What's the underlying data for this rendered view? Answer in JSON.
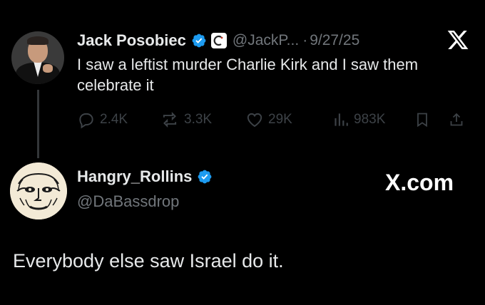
{
  "tweet1": {
    "author_name": "Jack Posobiec",
    "handle": "@JackP...",
    "separator": "·",
    "date": "9/27/25",
    "text": "I saw a leftist murder Charlie Kirk and I saw them celebrate it",
    "replies": "2.4K",
    "reposts": "3.3K",
    "likes": "29K",
    "views": "983K",
    "icons": {
      "verified": "verified-badge-icon",
      "affiliate": "affiliate-badge-icon",
      "platform": "x-logo-icon",
      "reply": "reply-icon",
      "repost": "repost-icon",
      "like": "like-icon",
      "views": "views-icon",
      "bookmark": "bookmark-icon",
      "share": "share-icon"
    }
  },
  "tweet2": {
    "author_name": "Hangry_Rollins",
    "handle": "@DaBassdrop",
    "text": "Everybody else saw Israel do it.",
    "icons": {
      "verified": "verified-badge-icon"
    }
  },
  "watermark": "X.com",
  "colors": {
    "background": "#000000",
    "text": "#e7e9ea",
    "muted": "#71767b",
    "action_icons": "#3d4247",
    "verified_blue": "#1d9bf0"
  }
}
